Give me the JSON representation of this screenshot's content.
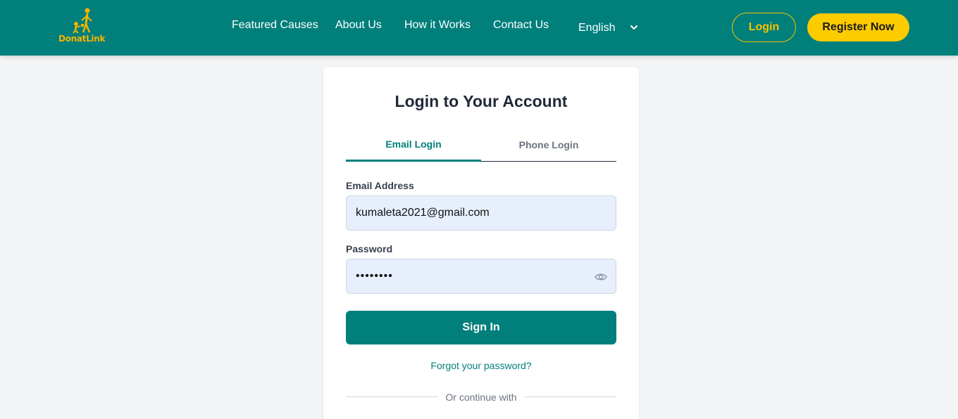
{
  "brand": {
    "logo_text": "DonatLink",
    "accent": "#007f7b",
    "gold": "#f5b400"
  },
  "nav": {
    "links": [
      "Featured Causes",
      "About Us",
      "How it Works",
      "Contact Us"
    ],
    "language": "English",
    "login_label": "Login",
    "register_label": "Register Now"
  },
  "login_card": {
    "title": "Login to Your Account",
    "tabs": [
      {
        "label": "Email Login",
        "active": true
      },
      {
        "label": "Phone Login",
        "active": false
      }
    ],
    "email_label": "Email Address",
    "email_value": "kumaleta2021@gmail.com",
    "password_label": "Password",
    "password_value": "••••••••",
    "password_toggle_icon": "eye-icon",
    "signin_label": "Sign In",
    "forgot_label": "Forgot your password?",
    "divider_text": "Or continue with"
  }
}
